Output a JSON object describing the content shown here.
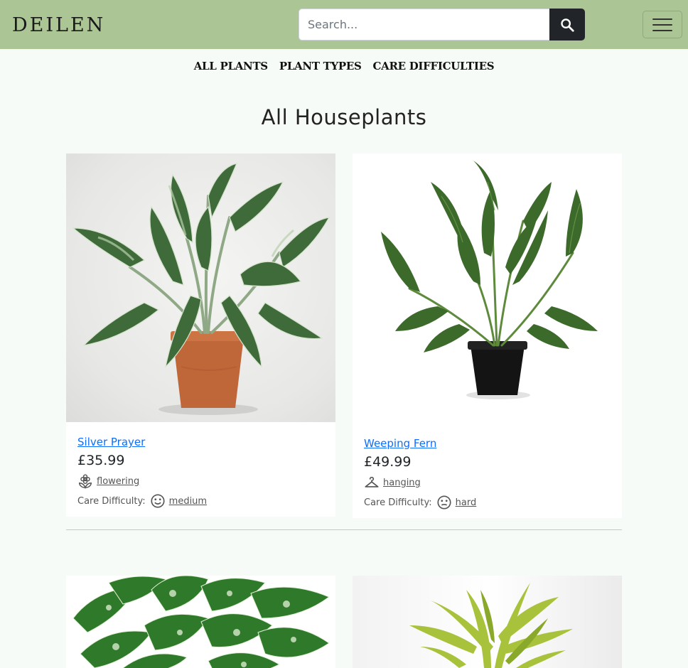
{
  "header": {
    "logo": "DEILEN",
    "search_placeholder": "Search...",
    "search_icon": "search-icon",
    "menu_icon": "hamburger-menu-icon"
  },
  "nav": {
    "items": [
      "ALL PLANTS",
      "PLANT TYPES",
      "CARE DIFFICULTIES"
    ]
  },
  "page": {
    "title": "All Houseplants"
  },
  "products": [
    {
      "name": "Silver Prayer",
      "price": "£35.99",
      "type": "flowering",
      "type_icon": "flower-icon",
      "care_label": "Care Difficulty:",
      "care": "medium",
      "care_icon": "smile-face-icon"
    },
    {
      "name": "Weeping Fern",
      "price": "£49.99",
      "type": "hanging",
      "type_icon": "hanger-icon",
      "care_label": "Care Difficulty:",
      "care": "hard",
      "care_icon": "neutral-face-icon"
    }
  ],
  "colors": {
    "topbar": "#abc595",
    "link": "#0d6efd",
    "search_button": "#212529"
  }
}
